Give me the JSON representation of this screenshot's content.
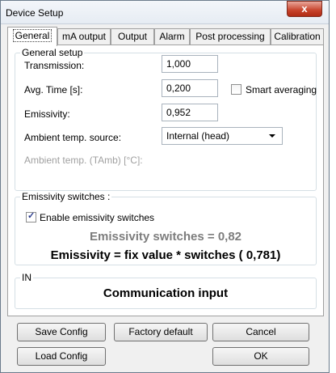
{
  "window": {
    "title": "Device Setup",
    "close_label": "x"
  },
  "tabs": [
    "General",
    "mA output",
    "Output",
    "Alarm",
    "Post processing",
    "Calibration"
  ],
  "general_setup": {
    "legend": "General setup",
    "transmission_label": "Transmission:",
    "transmission_value": "1,000",
    "avg_time_label": "Avg. Time [s]:",
    "avg_time_value": "0,200",
    "smart_averaging_label": "Smart averaging",
    "smart_averaging_checked": false,
    "emissivity_label": "Emissivity:",
    "emissivity_value": "0,952",
    "ambient_source_label": "Ambient temp. source:",
    "ambient_source_value": "Internal (head)",
    "ambient_temp_label": "Ambient temp. (TAmb) [°C]:"
  },
  "emissivity_switches": {
    "legend": "Emissivity switches :",
    "enable_label": "Enable emissivity switches",
    "enable_checked": true,
    "switches_text": "Emissivity switches = 0,82",
    "formula_text": "Emissivity = fix value * switches ( 0,781)"
  },
  "input_group": {
    "legend": "IN",
    "text": "Communication input"
  },
  "buttons": {
    "save_config": "Save Config",
    "factory_default": "Factory default",
    "cancel": "Cancel",
    "load_config": "Load Config",
    "ok": "OK"
  }
}
